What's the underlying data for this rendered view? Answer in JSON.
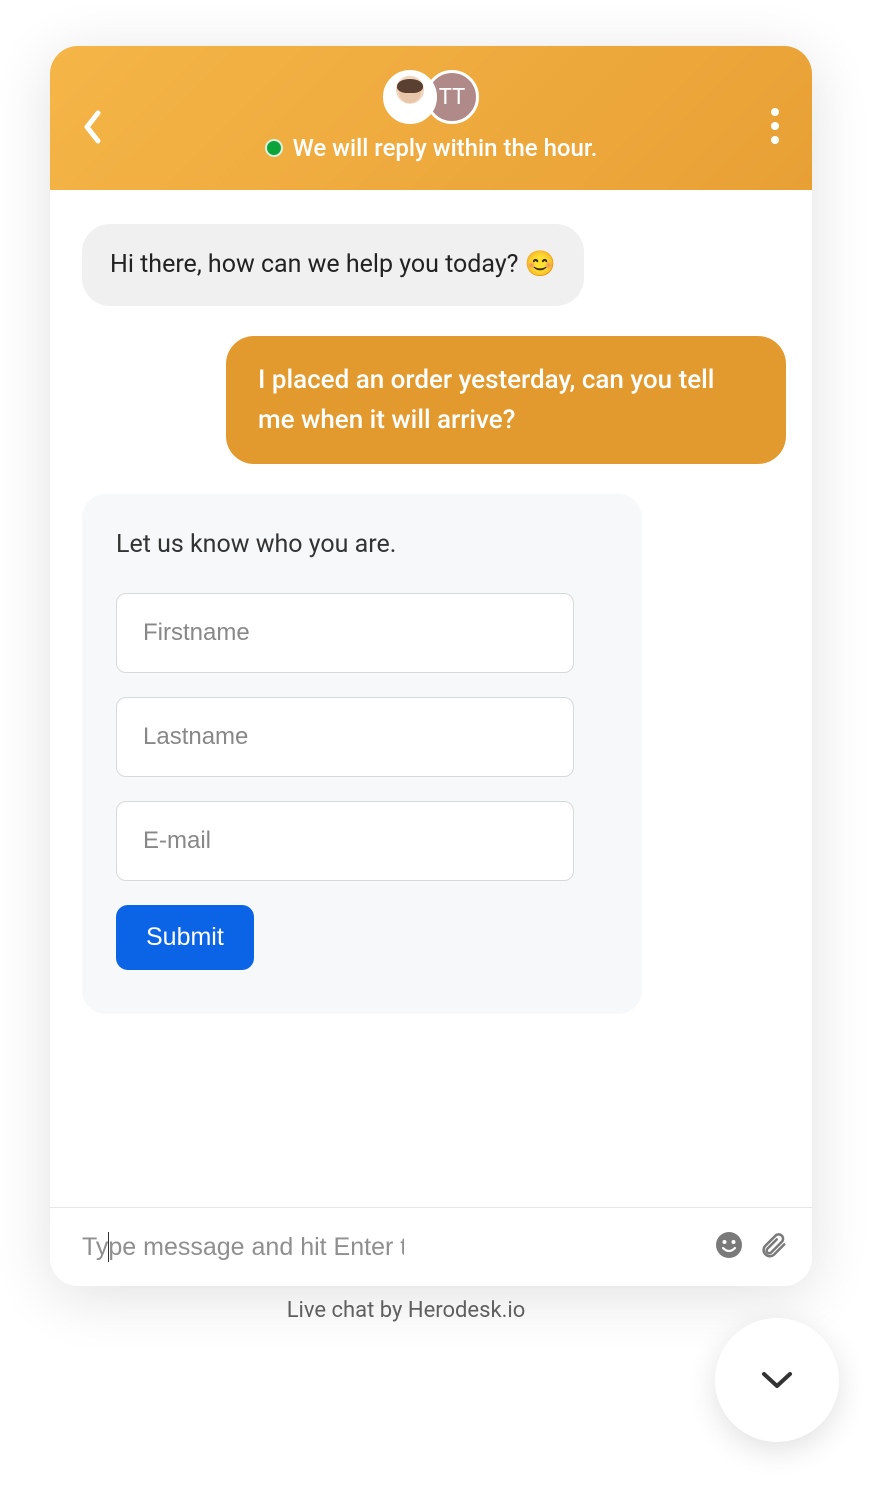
{
  "colors": {
    "accent": "#e29a2f",
    "header_gradient_from": "#f5b547",
    "header_gradient_to": "#e8a035",
    "submit_bg": "#0b63e6",
    "status_dot": "#0ca33a"
  },
  "header": {
    "status_text": "We will reply within the hour.",
    "avatar2_text": "TT"
  },
  "messages": {
    "incoming_1": "Hi there, how can we help you today? 😊",
    "outgoing_1": "I placed an order yesterday, can you tell me when it will arrive?"
  },
  "form": {
    "title": "Let us know who you are.",
    "firstname_placeholder": "Firstname",
    "lastname_placeholder": "Lastname",
    "email_placeholder": "E-mail",
    "submit_label": "Submit"
  },
  "composer": {
    "placeholder": "Type message and hit Enter to send..."
  },
  "footer": {
    "text": "Live chat by Herodesk.io"
  }
}
